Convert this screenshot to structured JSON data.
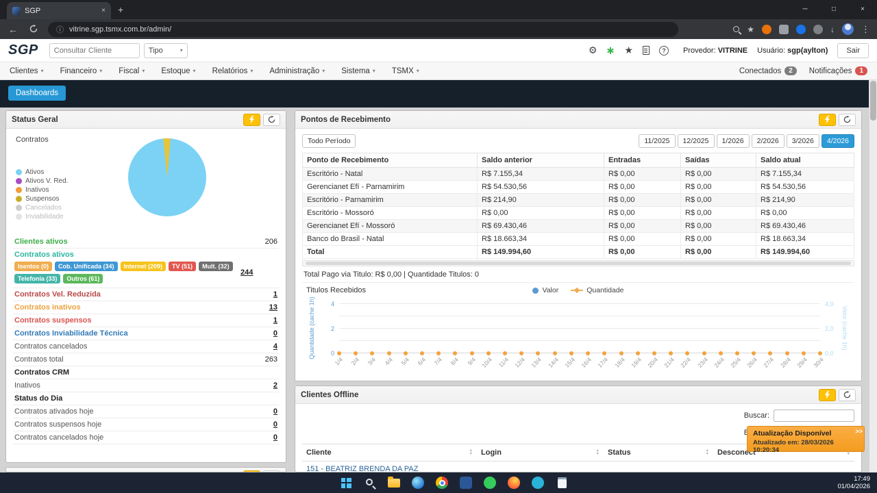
{
  "icons": {
    "close": "×",
    "minimize": "─",
    "maximize": "□",
    "plus": "+",
    "back": "←",
    "menu": "⋮",
    "info": "ⓘ",
    "caret": "▾",
    "gear": "⚙",
    "star": "★",
    "question": "?",
    "download": "↓",
    "sort_up": "▲",
    "sort_down": "▼"
  },
  "browser": {
    "tab_title": "SGP",
    "url": "vitrine.sgp.tsmx.com.br/admin/"
  },
  "app_header": {
    "logo": "SGP",
    "search_placeholder": "Consultar Cliente",
    "type_value": "Tipo",
    "provider_label": "Provedor:",
    "provider_value": "VITRINE",
    "user_label": "Usuário:",
    "user_value": "sgp(aylton)",
    "logout_label": "Sair"
  },
  "nav": {
    "items": [
      "Clientes",
      "Financeiro",
      "Fiscal",
      "Estoque",
      "Relatórios",
      "Administração",
      "Sistema",
      "TSMX"
    ],
    "connected_label": "Conectados",
    "connected_count": "2",
    "notifications_label": "Notificações",
    "notifications_count": "1"
  },
  "toolbar": {
    "dashboards_label": "Dashboards"
  },
  "status_panel": {
    "title": "Status Geral",
    "pie_label": "Contratos",
    "pie": {
      "slices": [
        {
          "label": "Suspensos",
          "color": "#e5c43e",
          "deg": 11
        },
        {
          "label": "Ativos",
          "color": "#7bd2f5",
          "deg": 349
        }
      ]
    },
    "legend": [
      {
        "label": "Ativos",
        "color": "#7bd2f5",
        "muted": false
      },
      {
        "label": "Ativos V. Red.",
        "color": "#a94dc1",
        "muted": false
      },
      {
        "label": "Inativos",
        "color": "#f19c38",
        "muted": false
      },
      {
        "label": "Suspensos",
        "color": "#c9ae25",
        "muted": false
      },
      {
        "label": "Cancelados",
        "color": "#cccccc",
        "muted": true
      },
      {
        "label": "Inviabilidade",
        "color": "#e3e3e3",
        "muted": true
      }
    ],
    "clientes_ativos": {
      "label": "Clientes ativos",
      "value": "206"
    },
    "contratos_ativos_label": "Contratos ativos",
    "badges": [
      {
        "label": "Isentos (0)",
        "color": "#f0ad4e"
      },
      {
        "label": "Cob. Unificada (34)",
        "color": "#3f97d3"
      },
      {
        "label": "Internet (209)",
        "color": "#f6c31c"
      },
      {
        "label": "TV (51)",
        "color": "#e2574f"
      },
      {
        "label": "Mult. (32)",
        "color": "#707070"
      },
      {
        "label": "Telefonia (33)",
        "color": "#43b5a8"
      },
      {
        "label": "Outros (61)",
        "color": "#5cb85c"
      }
    ],
    "badges_total": "244",
    "rows": [
      {
        "type": "row",
        "label": "Contratos Vel. Reduzida",
        "value": "1",
        "cls": "c-darkred",
        "link": true
      },
      {
        "type": "row",
        "label": "Contratos inativos",
        "value": "13",
        "cls": "c-orange",
        "link": true
      },
      {
        "type": "row",
        "label": "Contratos suspensos",
        "value": "1",
        "cls": "c-redorange",
        "link": true
      },
      {
        "type": "row",
        "label": "Contratos Inviabilidade Técnica",
        "value": "0",
        "cls": "c-blue",
        "link": true
      },
      {
        "type": "row",
        "label": "Contratos cancelados",
        "value": "4",
        "cls": "",
        "link": true
      },
      {
        "type": "row",
        "label": "Contratos total",
        "value": "263",
        "cls": "",
        "link": false
      },
      {
        "type": "header",
        "label": "Contratos CRM"
      },
      {
        "type": "row",
        "label": "Inativos",
        "value": "2",
        "cls": "",
        "link": true
      },
      {
        "type": "header",
        "label": "Status do Dia"
      },
      {
        "type": "row",
        "label": "Contratos ativados hoje",
        "value": "0",
        "cls": "",
        "link": true
      },
      {
        "type": "row",
        "label": "Contratos suspensos hoje",
        "value": "0",
        "cls": "",
        "link": true
      },
      {
        "type": "row",
        "label": "Contratos cancelados hoje",
        "value": "0",
        "cls": "",
        "link": true
      }
    ]
  },
  "pontos_panel": {
    "title": "Pontos de Recebimento",
    "period_label": "Todo Período",
    "months": [
      "11/2025",
      "12/2025",
      "1/2026",
      "2/2026",
      "3/2026",
      "4/2026"
    ],
    "active_month": "4/2026",
    "table": {
      "headers": [
        "Ponto de Recebimento",
        "Saldo anterior",
        "Entradas",
        "Saídas",
        "Saldo atual"
      ],
      "rows": [
        [
          "Escritório - Natal",
          "R$ 7.155,34",
          "R$ 0,00",
          "R$ 0,00",
          "R$ 7.155,34"
        ],
        [
          "Gerencianet Efí - Parnamirim",
          "R$ 54.530,56",
          "R$ 0,00",
          "R$ 0,00",
          "R$ 54.530,56"
        ],
        [
          "Escritório - Parnamirim",
          "R$ 214,90",
          "R$ 0,00",
          "R$ 0,00",
          "R$ 214,90"
        ],
        [
          "Escritório - Mossoró",
          "R$ 0,00",
          "R$ 0,00",
          "R$ 0,00",
          "R$ 0,00"
        ],
        [
          "Gerencianet Efí - Mossoró",
          "R$ 69.430,46",
          "R$ 0,00",
          "R$ 0,00",
          "R$ 69.430,46"
        ],
        [
          "Banco do Brasil - Natal",
          "R$ 18.663,34",
          "R$ 0,00",
          "R$ 0,00",
          "R$ 18.663,34"
        ]
      ],
      "total": [
        "Total",
        "R$ 149.994,60",
        "R$ 0,00",
        "R$ 0,00",
        "R$ 149.994,60"
      ]
    },
    "summary": "Total Pago via Titulo: R$ 0,00 | Quantidade Titulos: 0",
    "chart": {
      "type": "line",
      "title": "Titulos Recebidos",
      "legend": [
        {
          "label": "Valor",
          "color": "#5b9bd5"
        },
        {
          "label": "Quantidade",
          "color": "#f0ad4e"
        }
      ],
      "left_axis": "Quantidade (cache 1h)",
      "right_axis": "Valor (cache 1h)",
      "left_ticks": [
        "4",
        "2",
        "0"
      ],
      "right_ticks": [
        "4,0",
        "2,0",
        "0,0"
      ],
      "x_labels": [
        "1/4",
        "2/4",
        "3/4",
        "4/4",
        "5/4",
        "6/4",
        "7/4",
        "8/4",
        "9/4",
        "10/4",
        "11/4",
        "12/4",
        "13/4",
        "14/4",
        "15/4",
        "16/4",
        "17/4",
        "18/4",
        "19/4",
        "20/4",
        "21/4",
        "22/4",
        "23/4",
        "24/4",
        "25/4",
        "26/4",
        "27/4",
        "28/4",
        "29/4",
        "30/4"
      ],
      "quantidade_values": [
        0,
        0,
        0,
        0,
        0,
        0,
        0,
        0,
        0,
        0,
        0,
        0,
        0,
        0,
        0,
        0,
        0,
        0,
        0,
        0,
        0,
        0,
        0,
        0,
        0,
        0,
        0,
        0,
        0,
        0
      ],
      "valor_values": [
        0,
        0,
        0,
        0,
        0,
        0,
        0,
        0,
        0,
        0,
        0,
        0,
        0,
        0,
        0,
        0,
        0,
        0,
        0,
        0,
        0,
        0,
        0,
        0,
        0,
        0,
        0,
        0,
        0,
        0
      ]
    }
  },
  "offline_panel": {
    "title": "Clientes Offline",
    "search_label": "Buscar:",
    "headers": [
      "Cliente",
      "Login",
      "Status",
      "Desconect"
    ],
    "rows": [
      [
        "151 - BEATRIZ BRENDA DA PAZ",
        "",
        "",
        ""
      ]
    ]
  },
  "toast": {
    "title": "Atualização Disponível",
    "subtitle": "Atualizado em: 28/03/2026 10:20:34",
    "expand_label": ">>"
  },
  "taskbar": {
    "time": "17:49",
    "date": "01/04/2026",
    "icons": [
      "windows-start",
      "search",
      "file-explorer",
      "edge",
      "chrome",
      "app-blue",
      "whatsapp",
      "firefox",
      "app-teal",
      "notepad"
    ]
  }
}
